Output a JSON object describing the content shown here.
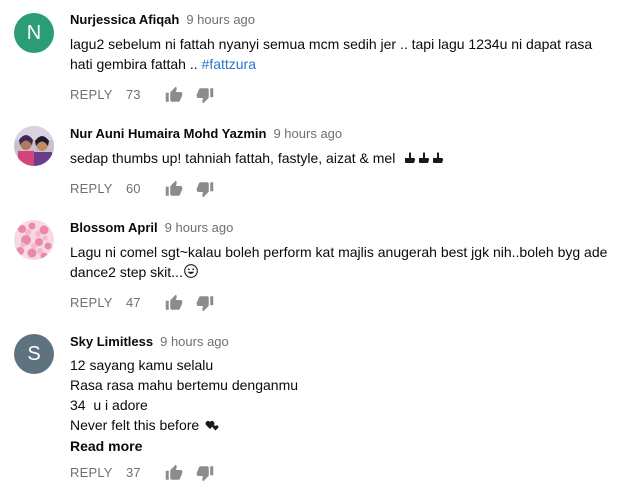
{
  "comments": [
    {
      "author": "Nurjessica Afiqah",
      "time": "9 hours ago",
      "avatar_letter": "N",
      "avatar_color": "#2a9d78",
      "text_line1": "lagu2 sebelum ni fattah nyanyi semua mcm sedih jer .. tapi lagu 1234u ni dapat rasa",
      "text_line2": "hati gembira fattah .. ",
      "hashtag": "#fattzura",
      "reply_label": "REPLY",
      "likes": "73"
    },
    {
      "author": "Nur Auni Humaira Mohd Yazmin",
      "time": "9 hours ago",
      "text": "sedap thumbs up! tahniah fattah, fastyle, aizat & mel",
      "emoji_icon": "pointing-hand-icons",
      "reply_label": "REPLY",
      "likes": "60"
    },
    {
      "author": "Blossom April",
      "time": "9 hours ago",
      "text_line1": "Lagu ni comel sgt~kalau boleh perform kat majlis anugerah best jgk nih..boleh byg ade",
      "text_line2": "dance2 step skit...",
      "emoji_icon": "grinning-face-icon",
      "reply_label": "REPLY",
      "likes": "47"
    },
    {
      "author": "Sky Limitless",
      "time": "9 hours ago",
      "avatar_letter": "S",
      "avatar_color": "#5f7280",
      "lines": [
        "12 sayang kamu selalu",
        "Rasa rasa mahu bertemu denganmu",
        "34  u i adore",
        "Never felt this before"
      ],
      "emoji_icon": "two-hearts-icon",
      "read_more": "Read more",
      "reply_label": "REPLY",
      "likes": "37"
    }
  ]
}
